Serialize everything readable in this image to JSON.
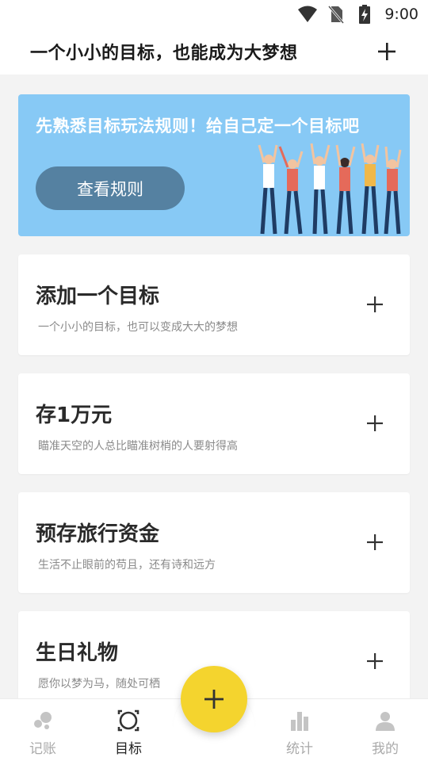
{
  "status_bar": {
    "time": "9:00",
    "icons": [
      "wifi-icon",
      "no-sim-icon",
      "battery-charging-icon"
    ]
  },
  "header": {
    "title": "一个小小的目标，也能成为大梦想",
    "add_icon": "plus-icon"
  },
  "banner": {
    "text": "先熟悉目标玩法规则！给自己定一个目标吧",
    "button_label": "查看规则",
    "background_color": "#87c9f5",
    "button_color": "#5581a1"
  },
  "goals": [
    {
      "title": "添加一个目标",
      "subtitle": "一个小小的目标，也可以变成大大的梦想"
    },
    {
      "title": "存1万元",
      "subtitle": "瞄准天空的人总比瞄准树梢的人要射得高"
    },
    {
      "title": "预存旅行资金",
      "subtitle": "生活不止眼前的苟且，还有诗和远方"
    },
    {
      "title": "生日礼物",
      "subtitle": "愿你以梦为马，随处可栖"
    }
  ],
  "tabbar": {
    "tabs": [
      {
        "label": "记账",
        "icon": "bookkeeping-icon",
        "active": false
      },
      {
        "label": "目标",
        "icon": "target-icon",
        "active": true
      },
      {
        "label": "统计",
        "icon": "bar-chart-icon",
        "active": false
      },
      {
        "label": "我的",
        "icon": "person-icon",
        "active": false
      }
    ],
    "fab_icon": "plus-icon",
    "fab_color": "#f4d42e"
  }
}
